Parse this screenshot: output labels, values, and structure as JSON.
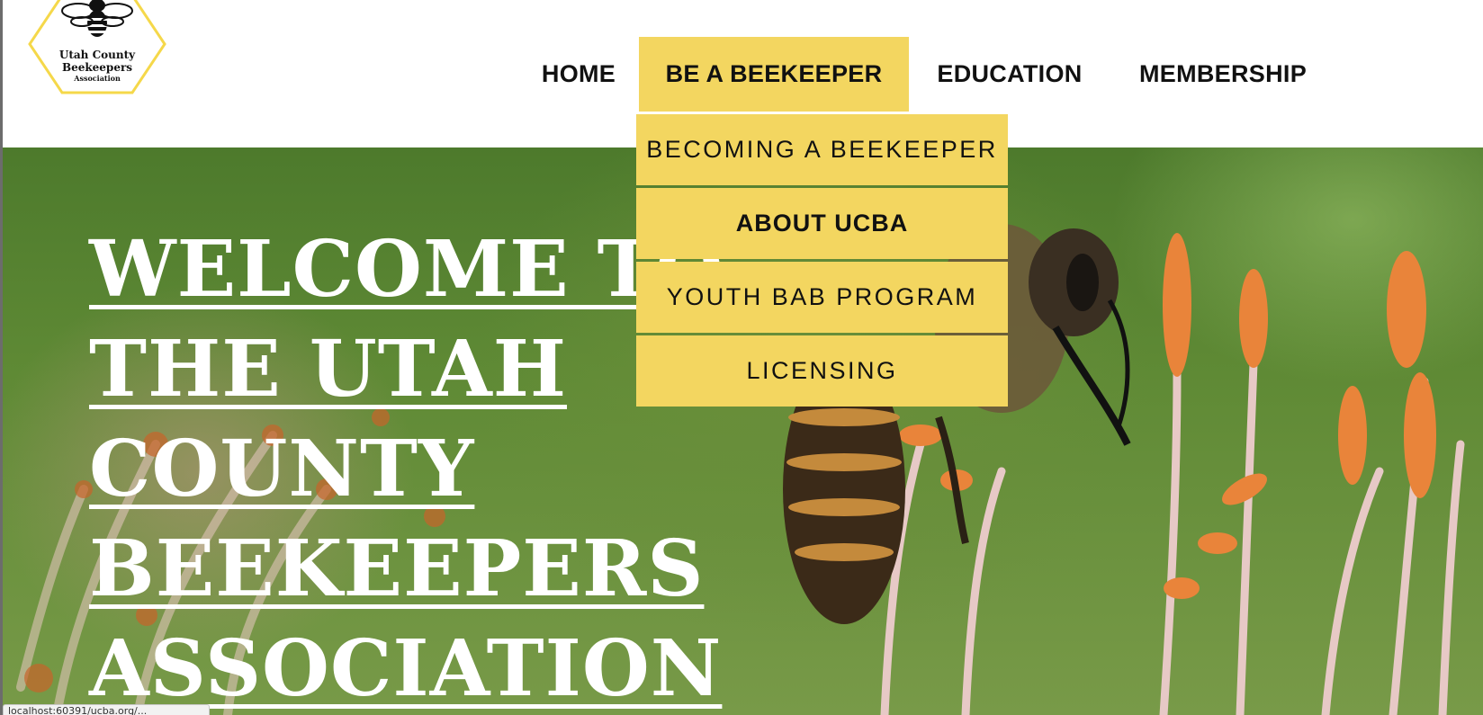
{
  "logo": {
    "line1": "Utah County",
    "line2": "Beekeepers",
    "line3": "Association",
    "icon": "bee-hexagon-logo"
  },
  "nav": {
    "items": [
      {
        "label": "HOME"
      },
      {
        "label": "BE A BEEKEEPER"
      },
      {
        "label": "EDUCATION"
      },
      {
        "label": "MEMBERSHIP"
      }
    ],
    "active_index": 1
  },
  "dropdown": {
    "items": [
      {
        "label": "BECOMING A BEEKEEPER"
      },
      {
        "label": "ABOUT UCBA"
      },
      {
        "label": "YOUTH BAB PROGRAM"
      },
      {
        "label": "LICENSING"
      }
    ],
    "hovered_index": 1
  },
  "hero": {
    "title_lines": [
      "WELCOME TO",
      "THE UTAH",
      "COUNTY",
      "BEEKEEPERS",
      "ASSOCIATION"
    ]
  },
  "status_bar": {
    "text": "localhost:60391/ucba.org/..."
  },
  "colors": {
    "accent_yellow": "#f3d660",
    "logo_hexagon": "#f5d84a",
    "text_dark": "#111111",
    "hero_text": "#ffffff"
  }
}
